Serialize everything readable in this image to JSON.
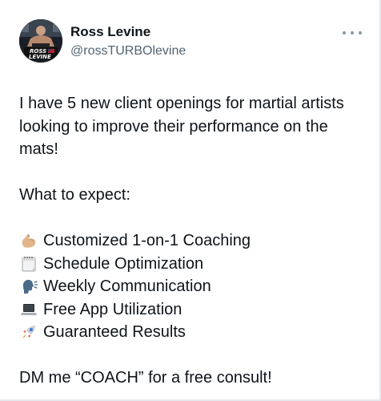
{
  "author": {
    "display_name": "Ross Levine",
    "handle": "@rossTURBOlevine",
    "avatar_text_line1": "ROSS",
    "avatar_text_line2": "LEVINE"
  },
  "post": {
    "intro": "I have 5 new client openings for martial artists looking to improve their performance on the mats!",
    "expect_heading": "What to expect:",
    "items": [
      {
        "icon": "flexed-biceps-emoji",
        "text": "Customized 1-on-1 Coaching"
      },
      {
        "icon": "calendar-emoji",
        "text": "Schedule Optimization"
      },
      {
        "icon": "speaking-head-emoji",
        "text": "Weekly Communication"
      },
      {
        "icon": "laptop-emoji",
        "text": "Free App Utilization"
      },
      {
        "icon": "rocket-emoji",
        "text": "Guaranteed Results"
      }
    ],
    "cta": "DM me “COACH” for a free consult!"
  },
  "colors": {
    "text": "#0f1419",
    "secondary_text": "#536471",
    "more_dots": "#8b98a5",
    "border": "#e6e9ec"
  }
}
